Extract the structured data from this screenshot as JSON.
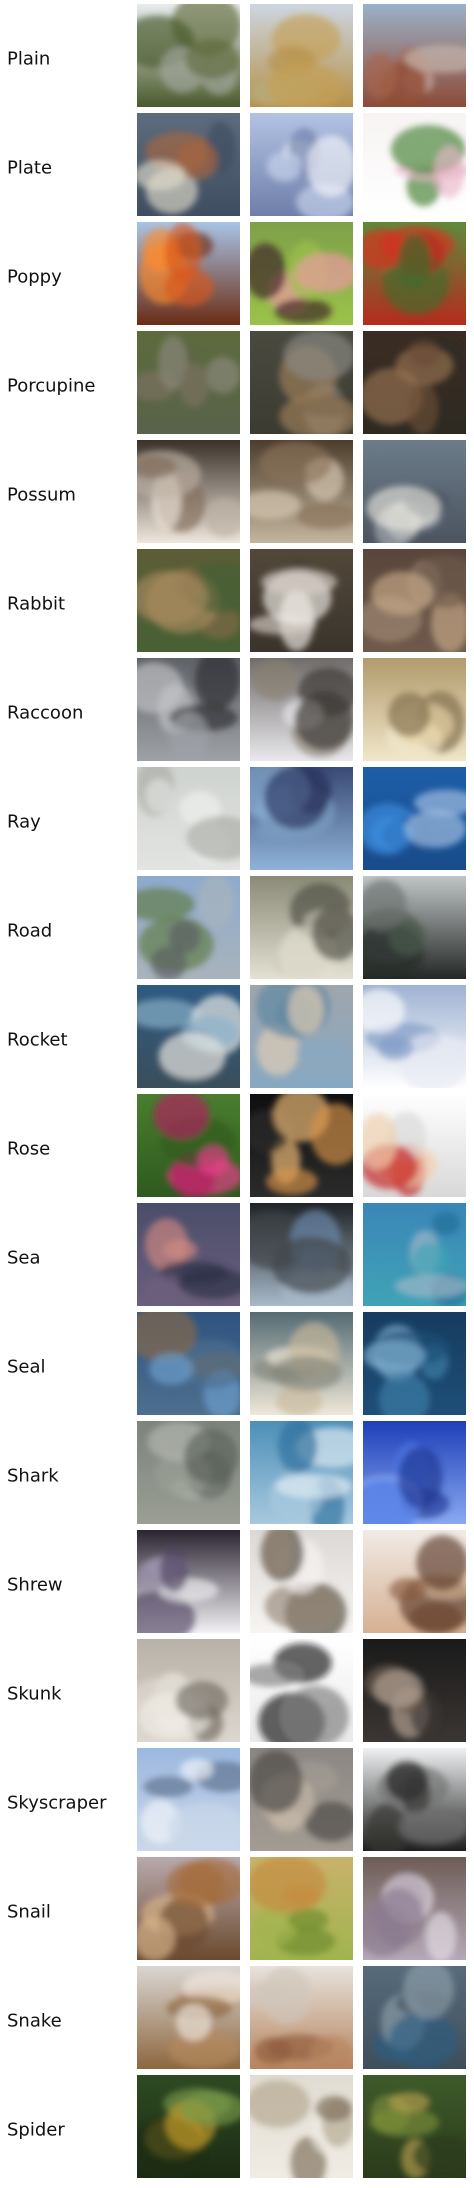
{
  "rows": [
    {
      "label": "Plain",
      "thumbs": [
        "grassland-photo",
        "field-with-tractor-photo",
        "misty-plain-photo"
      ]
    },
    {
      "label": "Plate",
      "thumbs": [
        "decorated-plate-photo",
        "white-plate-photo",
        "green-rim-plate-photo"
      ]
    },
    {
      "label": "Poppy",
      "thumbs": [
        "orange-poppies-photo",
        "pink-poppy-photo",
        "red-poppy-photo"
      ]
    },
    {
      "label": "Porcupine",
      "thumbs": [
        "porcupine-photo-1",
        "porcupine-photo-2",
        "porcupine-photo-3"
      ]
    },
    {
      "label": "Possum",
      "thumbs": [
        "possum-photo-1",
        "possum-photo-2",
        "possum-photo-3"
      ]
    },
    {
      "label": "Rabbit",
      "thumbs": [
        "rabbit-in-grass-photo",
        "white-rabbit-photo",
        "rabbit-on-log-photo"
      ]
    },
    {
      "label": "Raccoon",
      "thumbs": [
        "raccoon-photo-1",
        "raccoon-photo-2",
        "raccoon-photo-3"
      ]
    },
    {
      "label": "Ray",
      "thumbs": [
        "ray-underside-photo",
        "ray-underwater-photo",
        "manta-ray-photo"
      ]
    },
    {
      "label": "Road",
      "thumbs": [
        "road-photo-1",
        "road-photo-2",
        "foggy-road-photo"
      ]
    },
    {
      "label": "Rocket",
      "thumbs": [
        "rocket-launch-photo",
        "rocket-over-water-photo",
        "rocket-liftoff-photo"
      ]
    },
    {
      "label": "Rose",
      "thumbs": [
        "pink-rose-photo",
        "yellow-rose-photo",
        "red-rose-in-hand-photo"
      ]
    },
    {
      "label": "Sea",
      "thumbs": [
        "sunset-sea-photo",
        "sea-through-trees-photo",
        "coastline-sea-photo"
      ]
    },
    {
      "label": "Seal",
      "thumbs": [
        "seal-on-rock-photo",
        "seal-closeup-photo",
        "seal-in-water-photo"
      ]
    },
    {
      "label": "Shark",
      "thumbs": [
        "shark-photo-1",
        "shark-jaws-photo",
        "shark-underwater-photo"
      ]
    },
    {
      "label": "Shrew",
      "thumbs": [
        "shrew-photo-1",
        "shrew-photo-2",
        "shrew-in-circle-photo"
      ]
    },
    {
      "label": "Skunk",
      "thumbs": [
        "white-skunk-photo",
        "skunks-photo",
        "skunk-in-grass-photo"
      ]
    },
    {
      "label": "Skyscraper",
      "thumbs": [
        "tower-photo-1",
        "building-angle-photo",
        "dark-building-photo"
      ]
    },
    {
      "label": "Snail",
      "thumbs": [
        "snail-on-hand-photo",
        "snail-on-leaf-photo",
        "striped-snail-photo"
      ]
    },
    {
      "label": "Snake",
      "thumbs": [
        "coiled-snake-photo",
        "brown-snake-photo",
        "blue-snake-photo"
      ]
    },
    {
      "label": "Spider",
      "thumbs": [
        "spider-in-web-photo",
        "small-spider-photo",
        "spider-on-web-photo"
      ]
    }
  ]
}
